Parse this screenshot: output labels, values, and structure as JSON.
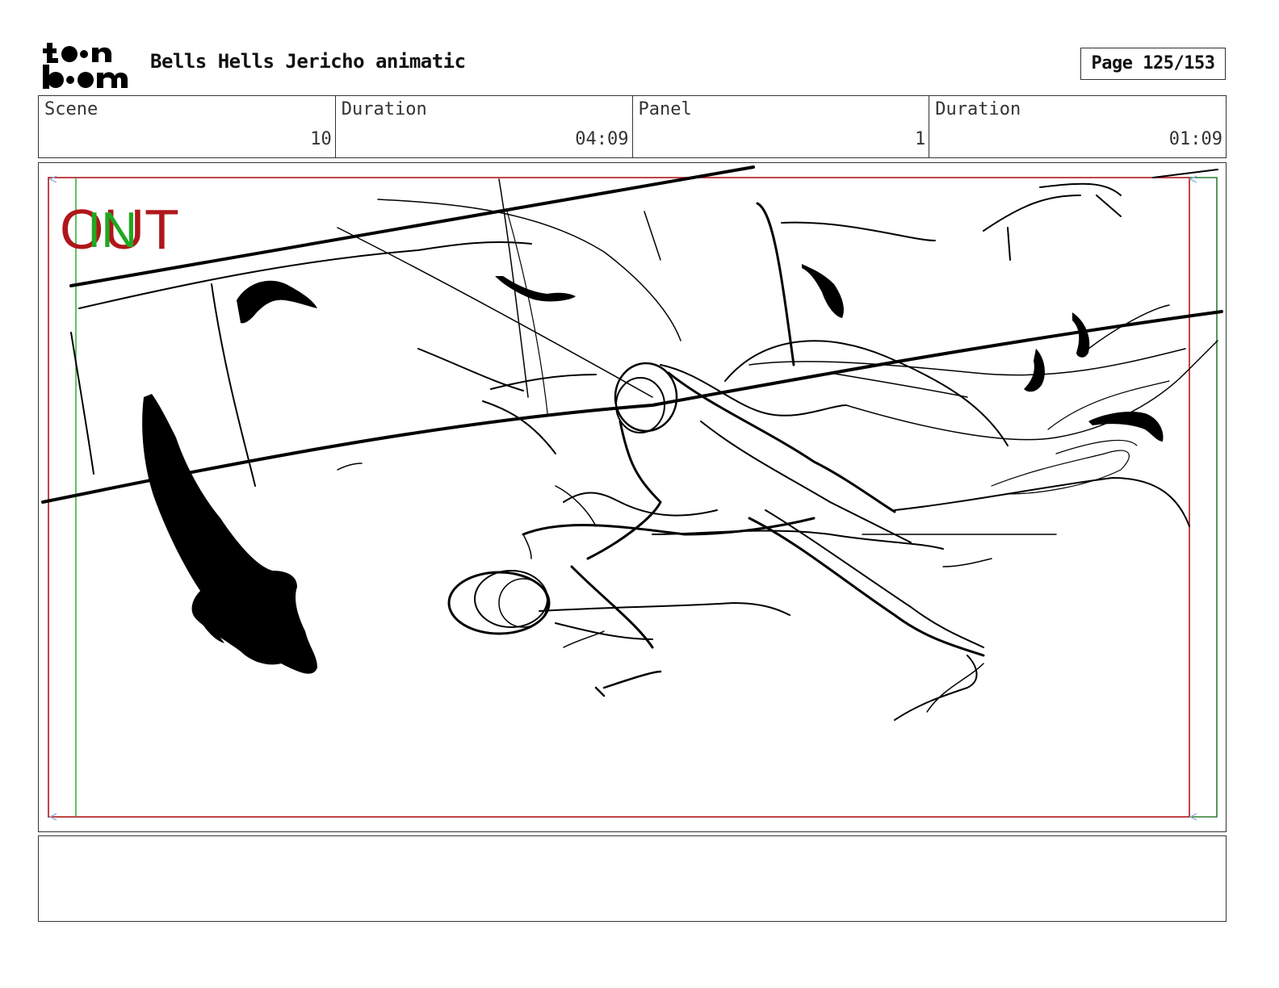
{
  "header": {
    "logo_text": "toonboom",
    "title": "Bells Hells Jericho animatic",
    "page_label": "Page 125/153"
  },
  "info": {
    "scene_label": "Scene",
    "scene_value": "10",
    "scene_duration_label": "Duration",
    "scene_duration_value": "04:09",
    "panel_label": "Panel",
    "panel_value": "1",
    "panel_duration_label": "Duration",
    "panel_duration_value": "01:09"
  },
  "panel": {
    "out_label": "OUT",
    "in_label": "IN",
    "colors": {
      "out": "#b0161b",
      "in": "#1fa81f",
      "frame_green": "#2e7d32",
      "arrow_blue": "#8fb0e0"
    }
  },
  "notes": {
    "text": ""
  }
}
